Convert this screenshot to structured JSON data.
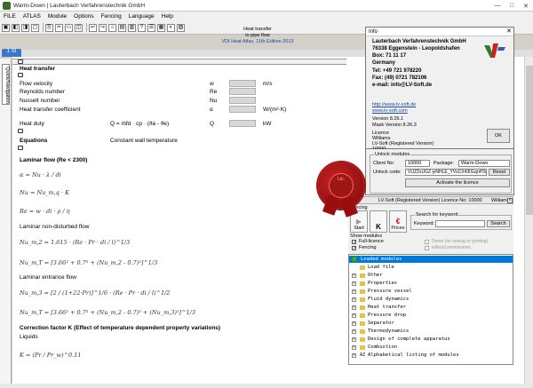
{
  "window": {
    "title": "Warm-Down  |  Lauterbach Verfahrenstechnik GmbH",
    "min": "—",
    "max": "□",
    "close": "✕"
  },
  "menu": [
    "FILE",
    "ATLAS",
    "Module",
    "Options",
    "Fencing",
    "Language",
    "Help"
  ],
  "toolbar_glyphs": [
    "▣",
    "◧",
    "◨",
    "▢",
    "⎘",
    "✂",
    "▭",
    "◫",
    "↩",
    "↪",
    "⌂",
    "▤",
    "▥",
    "?",
    "☰",
    "▦",
    "◐",
    "▧"
  ],
  "doc_header": {
    "line1": "Heat transfer",
    "line2": "in pipe flow",
    "line3": "VDI Heat Atlas, 11th Edition 2013"
  },
  "tab": {
    "label": "1 SI"
  },
  "side_tab": {
    "label": "Quick/Navigation"
  },
  "heat_transfer": {
    "title": "Heat transfer",
    "rows": [
      {
        "label": "Flow velocity",
        "sym": "w",
        "unit": "m/s"
      },
      {
        "label": "Reynolds number",
        "sym": "Re",
        "unit": ""
      },
      {
        "label": "Nusselt number",
        "sym": "Nu",
        "unit": ""
      },
      {
        "label": "Heat transfer coefficient",
        "sym": "α",
        "unit": "W/(m²·K)"
      },
      {
        "label": "Heat duty",
        "formula": "Q = ṁfd · cp · (ϑa - ϑe)",
        "sym": "Q",
        "unit": "kW"
      }
    ]
  },
  "equations": {
    "title": "Equations",
    "text": "Constant wall temperature"
  },
  "laminar": {
    "title": "Laminar flow (Re < 2300)",
    "f1": "α = Nu · λ / di",
    "f2": "Nu = Nu_m,q · K",
    "f3": "Re = w · di · ρ / η",
    "nd_title": "Laminar non-disturbed flow",
    "f4": "Nu_m,2 = 1.615 · (Re · Pr · di / l)^1/3",
    "f5": "Nu_m,T = [3.66³ + 0.7³ + (Nu_m,2 - 0.7)³]^1/3",
    "ent_title": "Laminar entrance flow",
    "f6": "Nu_m,3 = [2 / (1+22·Pr)]^1/6 · (Re · Pr · di / l)^1/2",
    "f7": "Nu_m,T = [3.66³ + 0.7³ + (Nu_m,2 - 0.7)³ + (Nu_m,3)³]^1/3",
    "corr_title": "Correction factor K (Effect of temperature dependent property variations)",
    "liquids": "Liquids",
    "f8": "K = (Pr / Pr_w)^0.11"
  },
  "info": {
    "title": "Info",
    "company": "Lauterbach Verfahrenstechnik GmbH",
    "street": "76338 Eggenstein - Leopoldshafen",
    "box": "Box: 71 11 17",
    "country": "Germany",
    "tel": "Tel:  +49  721  978220",
    "fax": "Fax: (49) 0721 782106",
    "email": "e-mail: info@LV-Soft.de",
    "url1": "http://www.lv-soft.de",
    "url2": "www.lv-soft.com",
    "version": "Version 8.26.1",
    "mask": "Mask Version 8.26.3",
    "licence_label": "Licence",
    "licence_user": "Williams",
    "licence_prog": "LV-Soft (Registered Version)",
    "licence_no": "10000",
    "ok": "OK"
  },
  "unlock": {
    "group": "Unlock modules",
    "client_label": "Client No:",
    "client_value": "10000",
    "package_label": "Package:",
    "package_value": "Warm-Down",
    "code_label": "Unlock code:",
    "code_value": "VUZZxUGZ·jvNHLE_YVsCX43IGzjnP3w",
    "reset": "Reset",
    "activate": "Activate the licence"
  },
  "licence_bar": {
    "text": "LV-Soft (Registered Version)   Licence No: 10000",
    "user": "Williams"
  },
  "fencing": {
    "label": "Fencing"
  },
  "buttons": {
    "start": "Start",
    "prices": "Prices",
    "k": "K"
  },
  "search": {
    "group": "Search for keyword",
    "label": "Keyword:",
    "value": "",
    "button": "Search"
  },
  "show_modules": {
    "group": "Show modules",
    "opt1": "Full-licence",
    "opt2": "Fencing",
    "opt3": "Demo (no saving or printing)",
    "opt4": "without permissions"
  },
  "tree": [
    {
      "label": "Loaded modules",
      "sel": true,
      "kind": "check"
    },
    {
      "label": "Load file",
      "kind": "folder"
    },
    {
      "label": "Other",
      "kind": "plus"
    },
    {
      "label": "Properties",
      "kind": "plus"
    },
    {
      "label": "Pressure vessel",
      "kind": "plus"
    },
    {
      "label": "Fluid dynamics",
      "kind": "plus"
    },
    {
      "label": "Heat transfer",
      "kind": "plus"
    },
    {
      "label": "Pressure drop",
      "kind": "plus"
    },
    {
      "label": "Separator",
      "kind": "plus"
    },
    {
      "label": "Thermodynamics",
      "kind": "plus"
    },
    {
      "label": "Design of complete apparatus",
      "kind": "plus"
    },
    {
      "label": "Combustion",
      "kind": "plus"
    },
    {
      "label": "Alphabetical listing of modules",
      "kind": "az"
    }
  ],
  "seal": {
    "text": "Lic."
  },
  "colors": {
    "selection": "#0078d7",
    "link": "#1a4aaa",
    "seal": "#b01515",
    "tab": "#3a78c8"
  }
}
